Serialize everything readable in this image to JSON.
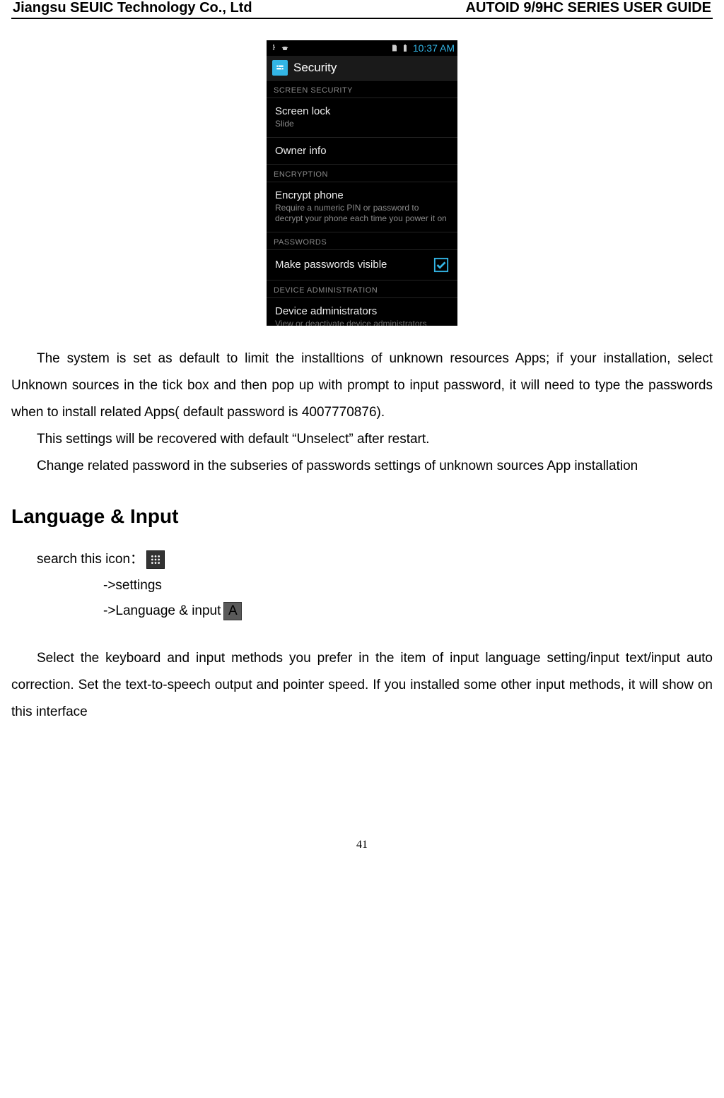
{
  "header": {
    "left": "Jiangsu SEUIC Technology Co., Ltd",
    "right": "AUTOID 9/9HC SERIES USER GUIDE"
  },
  "phone": {
    "time": "10:37 AM",
    "title": "Security",
    "sections": {
      "screen_security": {
        "header": "SCREEN SECURITY",
        "screen_lock": {
          "title": "Screen lock",
          "value": "Slide"
        },
        "owner_info": {
          "title": "Owner info"
        }
      },
      "encryption": {
        "header": "ENCRYPTION",
        "encrypt_phone": {
          "title": "Encrypt phone",
          "desc": "Require a numeric PIN or password to decrypt your phone each time you power it on"
        }
      },
      "passwords": {
        "header": "PASSWORDS",
        "make_visible": {
          "title": "Make passwords visible"
        }
      },
      "device_admin": {
        "header": "DEVICE ADMINISTRATION",
        "device_admins": {
          "title": "Device administrators",
          "desc": "View or deactivate device administrators"
        }
      }
    }
  },
  "body": {
    "p1": "The system is set as default to limit the installtions of unknown resources Apps; if your installation, select Unknown sources in the tick box and then pop up with prompt to input password, it will need to type the passwords when to install related Apps( default password is 4007770876).",
    "p2": "This settings will be recovered with default “Unselect” after restart.",
    "p3": "Change related password in the subseries of passwords settings of unknown sources App installation"
  },
  "heading": "Language & Input",
  "nav": {
    "search_icon_text": "search this icon：",
    "path1": "->settings",
    "path2": "->Language & input"
  },
  "body2": {
    "p1": "Select the keyboard and input methods you prefer in the item of input language setting/input text/input auto correction. Set the text-to-speech output and pointer speed. If you installed some other input methods, it will show on this interface"
  },
  "page_number": "41"
}
